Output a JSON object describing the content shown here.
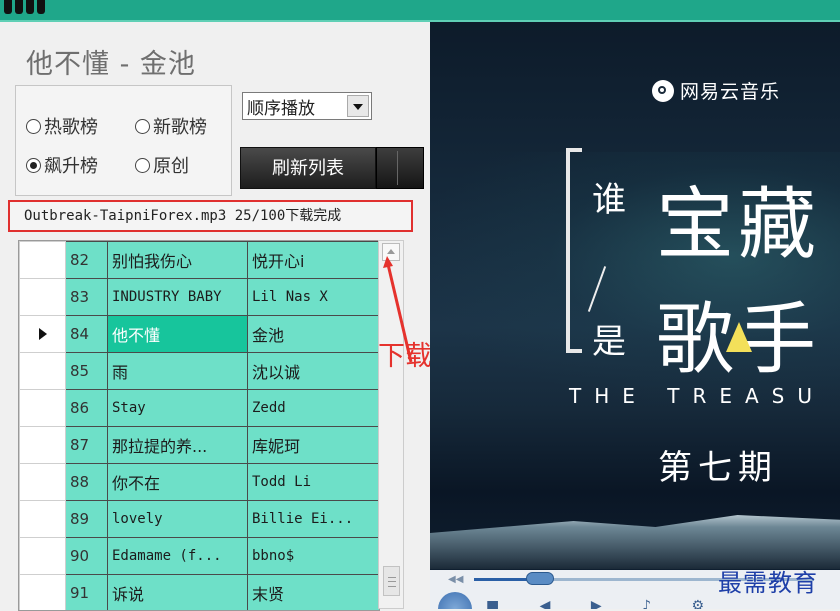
{
  "now_playing": {
    "title": "他不懂 - 金池"
  },
  "chart_options": [
    {
      "label": "热歌榜",
      "checked": false
    },
    {
      "label": "新歌榜",
      "checked": false
    },
    {
      "label": "飙升榜",
      "checked": true
    },
    {
      "label": "原创",
      "checked": false
    }
  ],
  "play_mode": {
    "selected": "顺序播放"
  },
  "refresh_button": {
    "label": "刷新列表"
  },
  "download_status": {
    "text": "Outbreak-TaipniForex.mp3 25/100下载完成"
  },
  "annotation": {
    "text": "下载进度提示",
    "color": "#e5322d"
  },
  "playlist": {
    "rows": [
      {
        "num": "82",
        "song": "别怕我伤心",
        "artist": "悦开心i",
        "current": false
      },
      {
        "num": "83",
        "song": "INDUSTRY BABY",
        "artist": "Lil Nas X",
        "current": false
      },
      {
        "num": "84",
        "song": "他不懂",
        "artist": "金池",
        "current": true
      },
      {
        "num": "85",
        "song": "雨",
        "artist": "沈以诚",
        "current": false
      },
      {
        "num": "86",
        "song": "Stay",
        "artist": "Zedd",
        "current": false
      },
      {
        "num": "87",
        "song": "那拉提的养...",
        "artist": "库妮珂",
        "current": false
      },
      {
        "num": "88",
        "song": "你不在",
        "artist": "Todd Li",
        "current": false
      },
      {
        "num": "89",
        "song": "lovely",
        "artist": "Billie Ei...",
        "current": false
      },
      {
        "num": "90",
        "song": "Edamame (f...",
        "artist": "bbno$",
        "current": false
      },
      {
        "num": "91",
        "song": "诉说",
        "artist": "末贤",
        "current": false
      }
    ]
  },
  "video": {
    "brand": "网易云音乐",
    "vertical_1": "谁",
    "vertical_2": "是",
    "headline_1": "宝藏",
    "headline_2": "歌手",
    "subtitle": "THE TREASU",
    "episode": "第七期"
  },
  "watermark": {
    "text": "最需教育"
  },
  "colors": {
    "titlebar": "#1fa78a",
    "row_bg": "#6ee0c8",
    "row_current": "#17c59c",
    "highlight_box": "#e0302f"
  }
}
